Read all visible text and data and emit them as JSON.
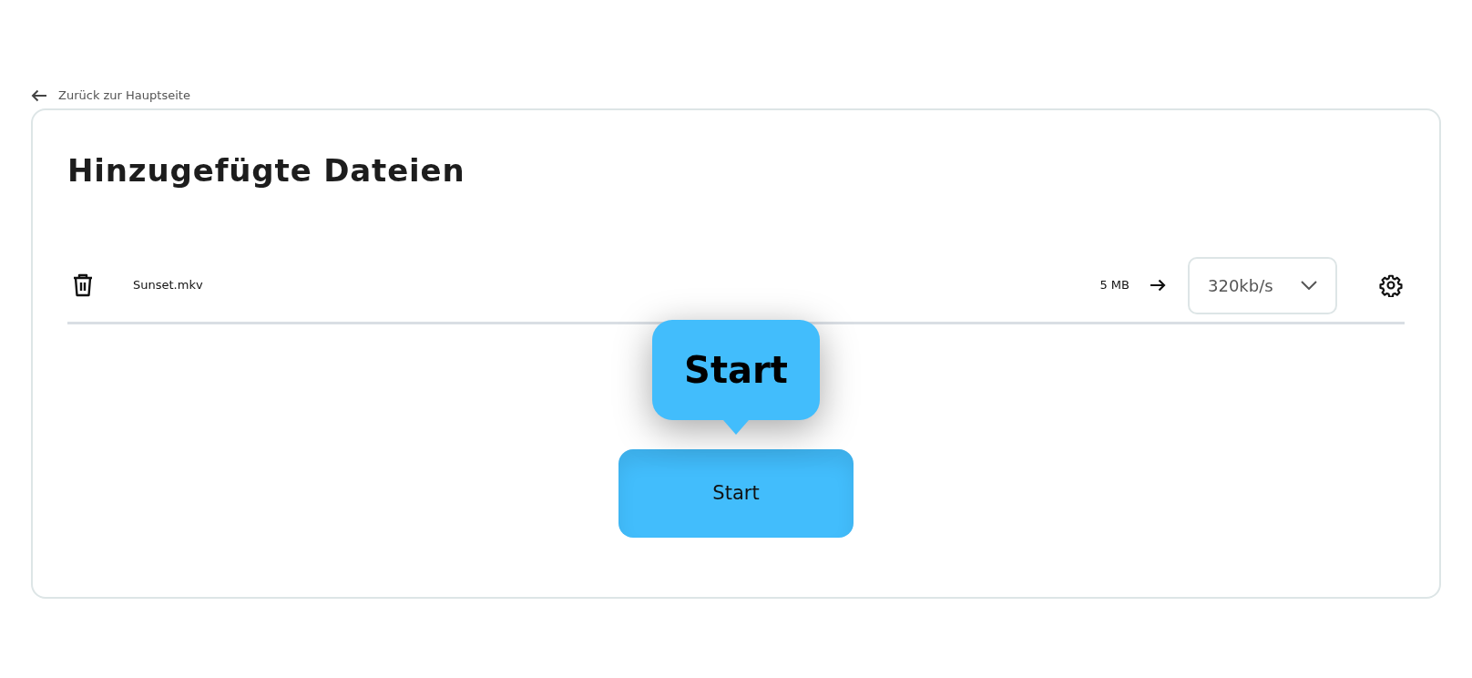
{
  "back_link": {
    "label": "Zurück zur Hauptseite"
  },
  "title": "Hinzugefügte Dateien",
  "files": [
    {
      "name": "Sunset.mkv",
      "size": "5 MB",
      "bitrate": "320kb/s"
    }
  ],
  "start_button": {
    "label": "Start"
  },
  "tooltip": {
    "text": "Start"
  }
}
